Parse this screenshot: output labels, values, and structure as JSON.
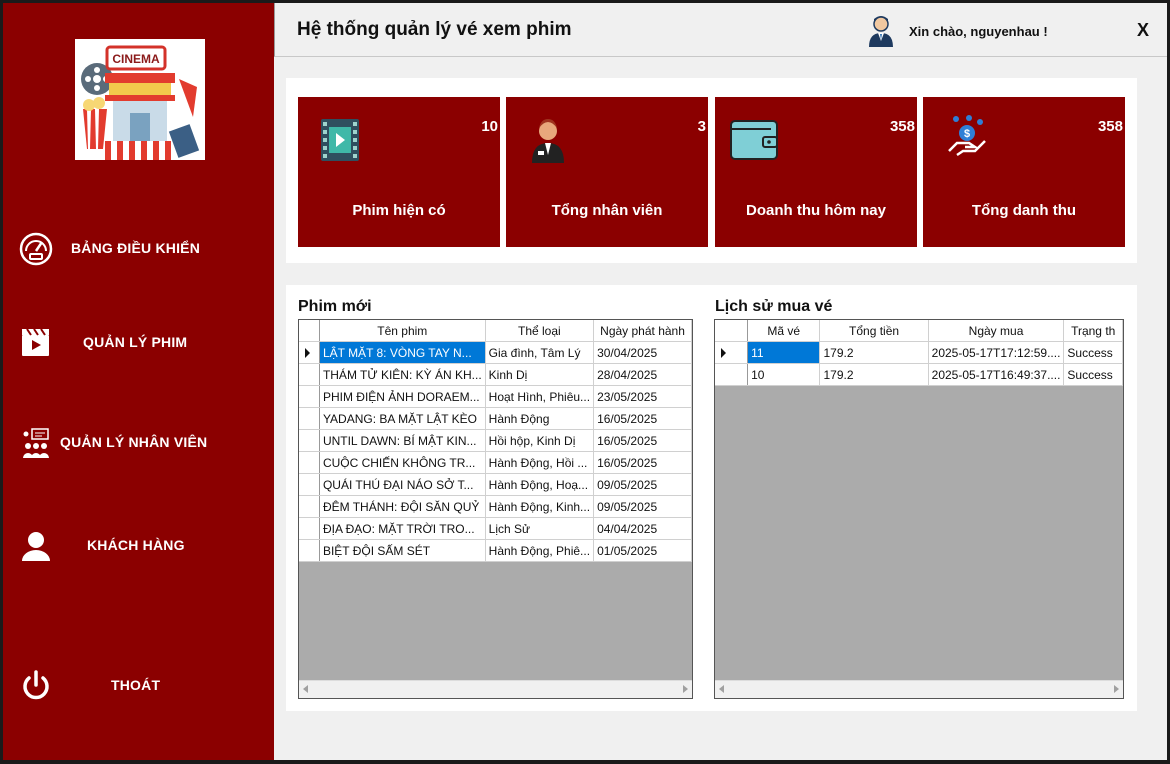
{
  "header": {
    "title": "Hệ thống quản lý vé xem phim",
    "greeting": "Xin chào, nguyenhau !",
    "close_label": "X"
  },
  "sidebar": {
    "logo_text": "CINEMA",
    "items": [
      {
        "label": "BẢNG ĐIỀU KHIỂN",
        "icon": "dashboard-gauge-icon"
      },
      {
        "label": "QUẢN LÝ PHIM",
        "icon": "film-clapper-icon"
      },
      {
        "label": "QUẢN LÝ NHÂN VIÊN",
        "icon": "staff-icon"
      },
      {
        "label": "KHÁCH HÀNG",
        "icon": "user-icon"
      },
      {
        "label": "THOÁT",
        "icon": "power-icon"
      }
    ]
  },
  "stats": [
    {
      "value": "10",
      "label": "Phim hiện có",
      "icon": "video-play-icon"
    },
    {
      "value": "3",
      "label": "Tổng nhân viên",
      "icon": "employee-icon"
    },
    {
      "value": "358",
      "label": "Doanh thu hôm nay",
      "icon": "wallet-icon"
    },
    {
      "value": "358",
      "label": "Tổng danh thu",
      "icon": "money-hand-icon"
    }
  ],
  "movies": {
    "title": "Phim mới",
    "columns": [
      "Tên phim",
      "Thể loại",
      "Ngày phát hành"
    ],
    "rows": [
      [
        "LẬT MẶT 8: VÒNG TAY N...",
        "Gia đình, Tâm Lý",
        "30/04/2025"
      ],
      [
        "THÁM TỬ KIÊN: KỲ ÁN KH...",
        "Kinh Dị",
        "28/04/2025"
      ],
      [
        "PHIM ĐIỆN ẢNH DORAEM...",
        "Hoạt Hình, Phiêu...",
        "23/05/2025"
      ],
      [
        "YADANG: BA MẶT LẬT KÈO",
        "Hành Động",
        "16/05/2025"
      ],
      [
        "UNTIL DAWN: BÍ MẬT KIN...",
        "Hồi hộp, Kinh Dị",
        "16/05/2025"
      ],
      [
        "CUỘC CHIẾN KHÔNG TR...",
        "Hành Động, Hồi ...",
        "16/05/2025"
      ],
      [
        "QUÁI THÚ ĐẠI NÁO SỞ T...",
        "Hành Động, Hoạ...",
        "09/05/2025"
      ],
      [
        "ĐÊM THÁNH: ĐỘI SĂN QUỶ",
        "Hành Động, Kinh...",
        "09/05/2025"
      ],
      [
        "ĐỊA ĐẠO: MẶT TRỜI TRO...",
        "Lịch Sử",
        "04/04/2025"
      ],
      [
        "BIỆT ĐỘI SẤM SÉT",
        "Hành Động, Phiê...",
        "01/05/2025"
      ]
    ]
  },
  "tickets": {
    "title": "Lịch sử mua vé",
    "columns": [
      "Mã vé",
      "Tổng tiền",
      "Ngày mua",
      "Trạng th"
    ],
    "rows": [
      [
        "11",
        "179.2",
        "2025-05-17T17:12:59....",
        "Success"
      ],
      [
        "10",
        "179.2",
        "2025-05-17T16:49:37....",
        "Success"
      ]
    ]
  }
}
